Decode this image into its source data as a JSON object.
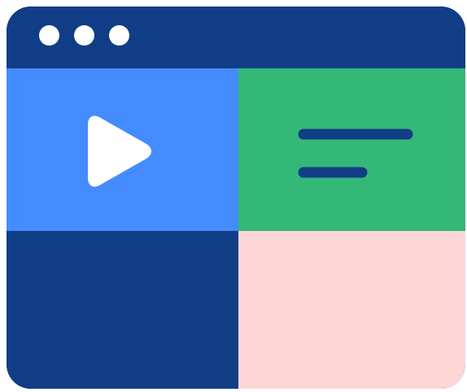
{
  "window": {
    "colors": {
      "frame": "#113d86",
      "titlebar_dots": "#ffffff",
      "video_panel": "#448cfe",
      "text_panel": "#34b878",
      "dark_panel": "#113d86",
      "pink_panel": "#fdd6d6",
      "text_lines": "#113d86",
      "play_glyph": "#ffffff"
    },
    "titlebar": {
      "dots": [
        "window-dot",
        "window-dot",
        "window-dot"
      ]
    },
    "panels": [
      {
        "name": "video-panel",
        "icon": "play-icon"
      },
      {
        "name": "text-panel",
        "icon": "text-lines-icon"
      },
      {
        "name": "dark-panel",
        "icon": ""
      },
      {
        "name": "pink-panel",
        "icon": ""
      }
    ]
  }
}
